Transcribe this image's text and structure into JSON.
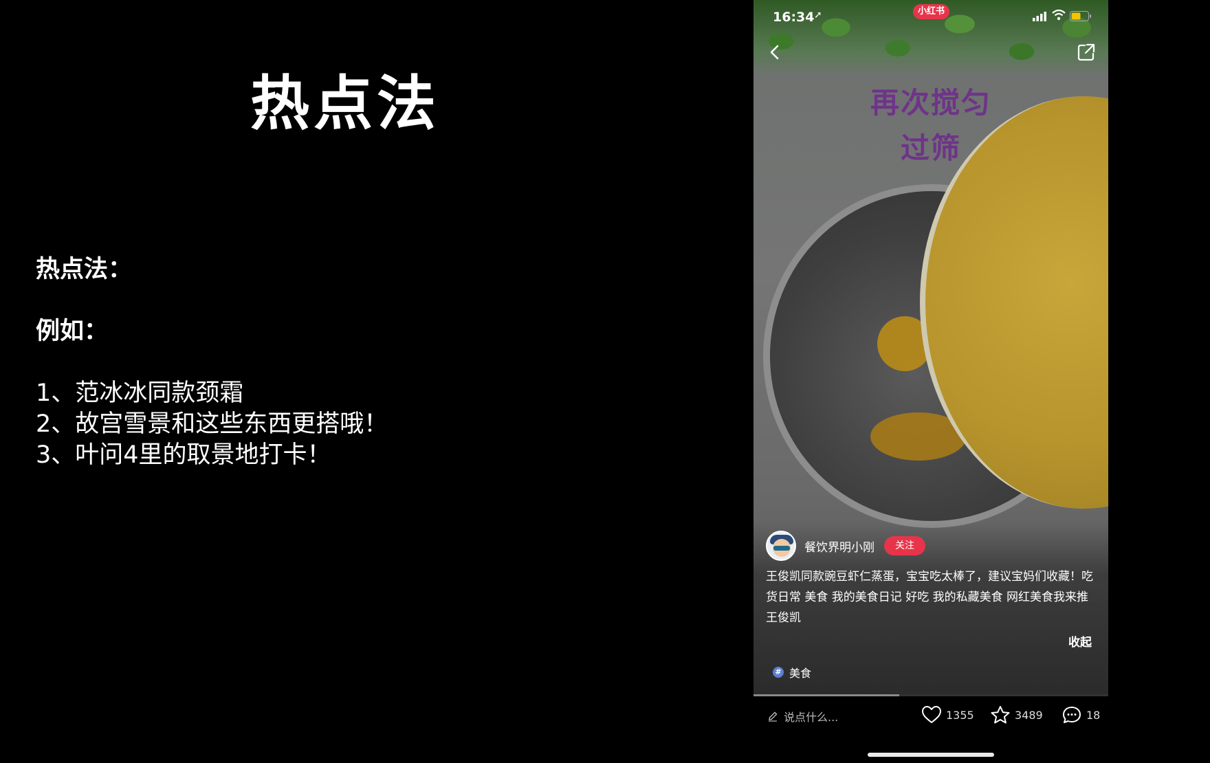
{
  "slide": {
    "title": "热点法",
    "heading": "热点法：",
    "example_label": "例如：",
    "items": [
      "1、范冰冰同款颈霜",
      "2、故宫雪景和这些东西更搭哦！",
      "3、叶问4里的取景地打卡！"
    ]
  },
  "phone": {
    "status": {
      "time": "16:34",
      "app_badge": "小红书"
    },
    "video": {
      "overlay_line1": "再次搅匀",
      "overlay_line2": "过筛",
      "progress": 0.41
    },
    "author": {
      "name": "餐饮界明小刚",
      "follow_label": "关注"
    },
    "caption": "王俊凯同款豌豆虾仁蒸蛋，宝宝吃太棒了，建议宝妈们收藏！吃货日常 美食 我的美食日记 好吃 我的私藏美食 网红美食我来推 王俊凯",
    "collapse_label": "收起",
    "topic": {
      "icon": "#",
      "label": "美食"
    },
    "bottom_bar": {
      "comment_placeholder": "说点什么...",
      "likes": "1355",
      "collects": "3489",
      "comments": "18"
    },
    "colors": {
      "accent": "#e8344a",
      "topic": "#5a7fd6"
    }
  }
}
